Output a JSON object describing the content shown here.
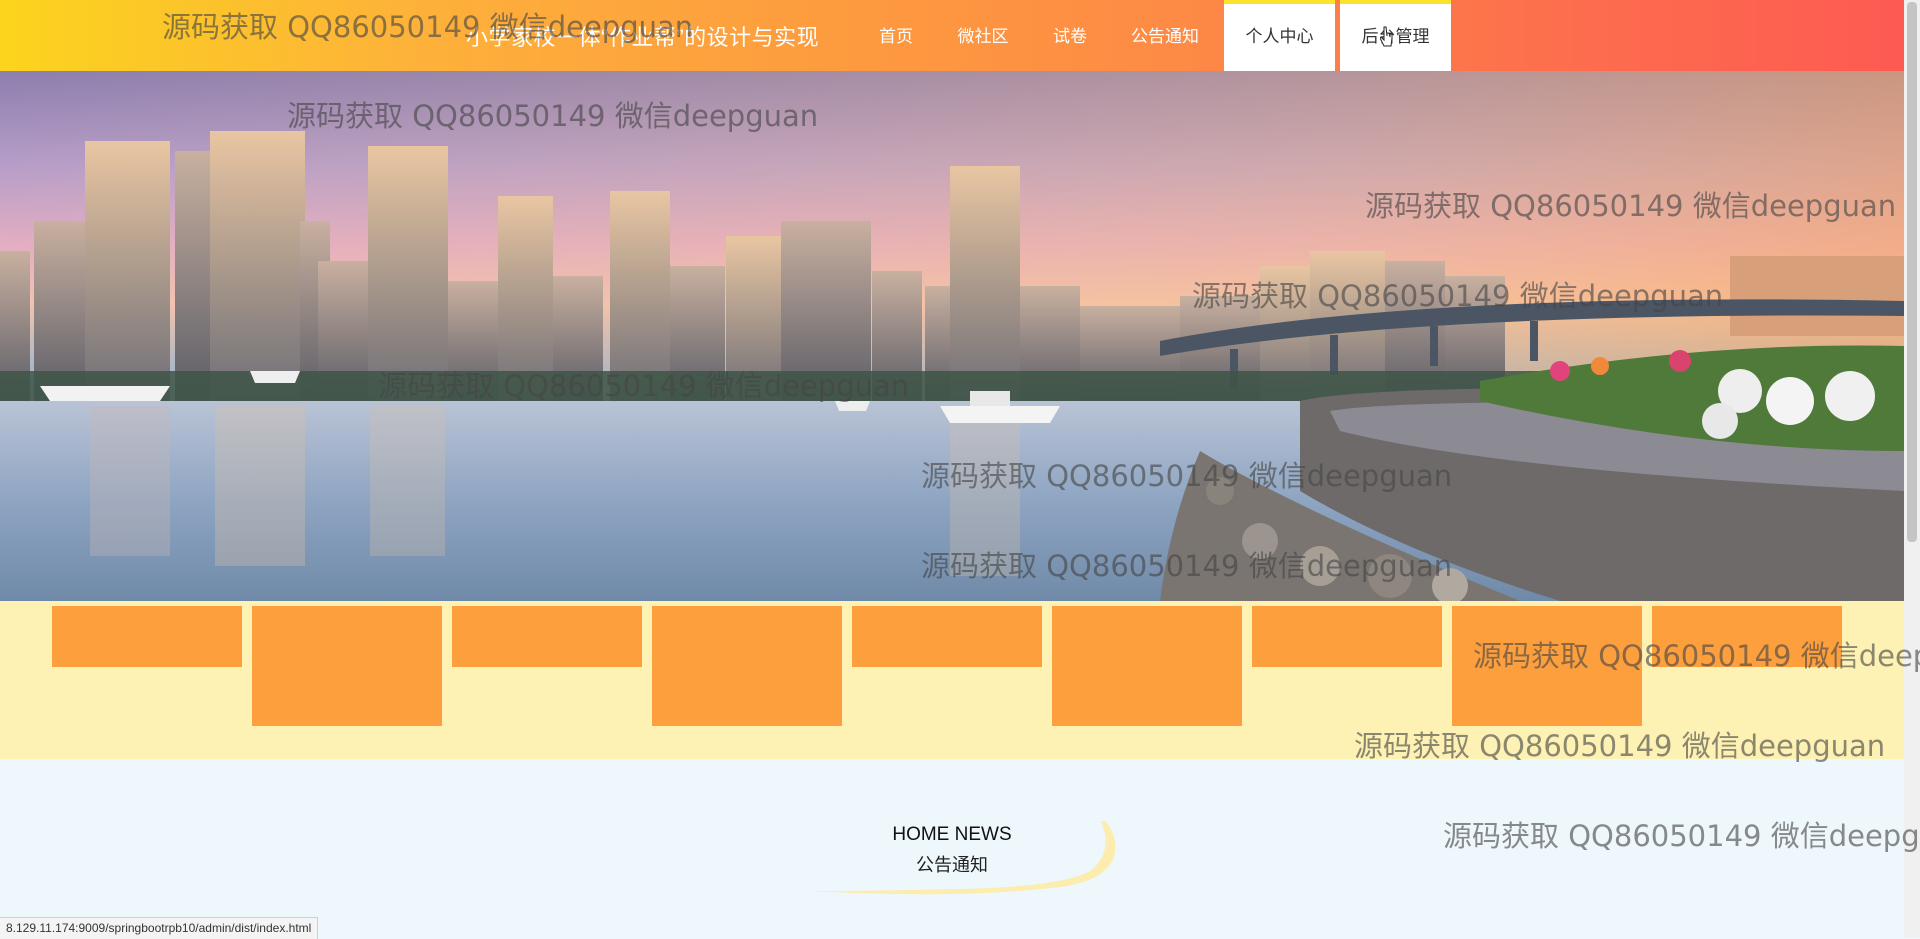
{
  "header": {
    "site_title": "小学家校一体“作业帮”的设计与实现",
    "nav": [
      {
        "label": "首页"
      },
      {
        "label": "微社区"
      },
      {
        "label": "试卷"
      },
      {
        "label": "公告通知"
      },
      {
        "label": "个人中心"
      },
      {
        "label": "后台管理"
      }
    ]
  },
  "banner": {
    "slide_count": 3,
    "active_slide": 1,
    "indicator_active_color": "#f5ee12"
  },
  "news": {
    "title_en": "HOME NEWS",
    "title_cn": "公告通知"
  },
  "status_bar": {
    "url": "8.129.11.174:9009/springbootrpb10/admin/dist/index.html"
  },
  "watermark": {
    "text": "源码获取 QQ86050149 微信deepguan"
  },
  "colors": {
    "nav_gradient_start": "#fcd41d",
    "nav_gradient_end": "#fd5a52",
    "tile_orange": "#fd9f3d",
    "strip_bg": "#fdf2b3",
    "news_bg": "#eef8fc"
  }
}
